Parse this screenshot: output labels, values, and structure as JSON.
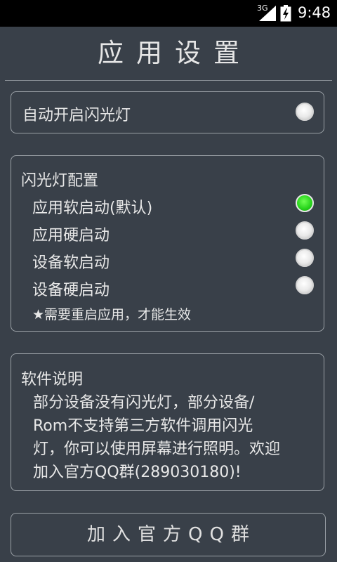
{
  "status_bar": {
    "network": "3G",
    "time": "9:48",
    "signal_icon": "signal-icon",
    "battery_icon": "battery-charging-icon"
  },
  "header": {
    "title": "应用设置"
  },
  "auto_flash": {
    "label": "自动开启闪光灯",
    "checked": false
  },
  "flash_config": {
    "title": "闪光灯配置",
    "options": [
      {
        "label": "应用软启动(默认)",
        "checked": true
      },
      {
        "label": "应用硬启动",
        "checked": false
      },
      {
        "label": "设备软启动",
        "checked": false
      },
      {
        "label": "设备硬启动",
        "checked": false
      }
    ],
    "note": "★需要重启应用，才能生效"
  },
  "about": {
    "title": "软件说明",
    "lines": [
      "部分设备没有闪光灯，部分设备/",
      "Rom不支持第三方软件调用闪光",
      "灯，你可以使用屏幕进行照明。欢迎",
      "加入官方QQ群(289030180)!"
    ]
  },
  "join_button": {
    "label": "加入官方QQ群"
  },
  "colors": {
    "background": "#394049",
    "selected_radio": "#25d21a",
    "border": "#9aa0a6"
  }
}
